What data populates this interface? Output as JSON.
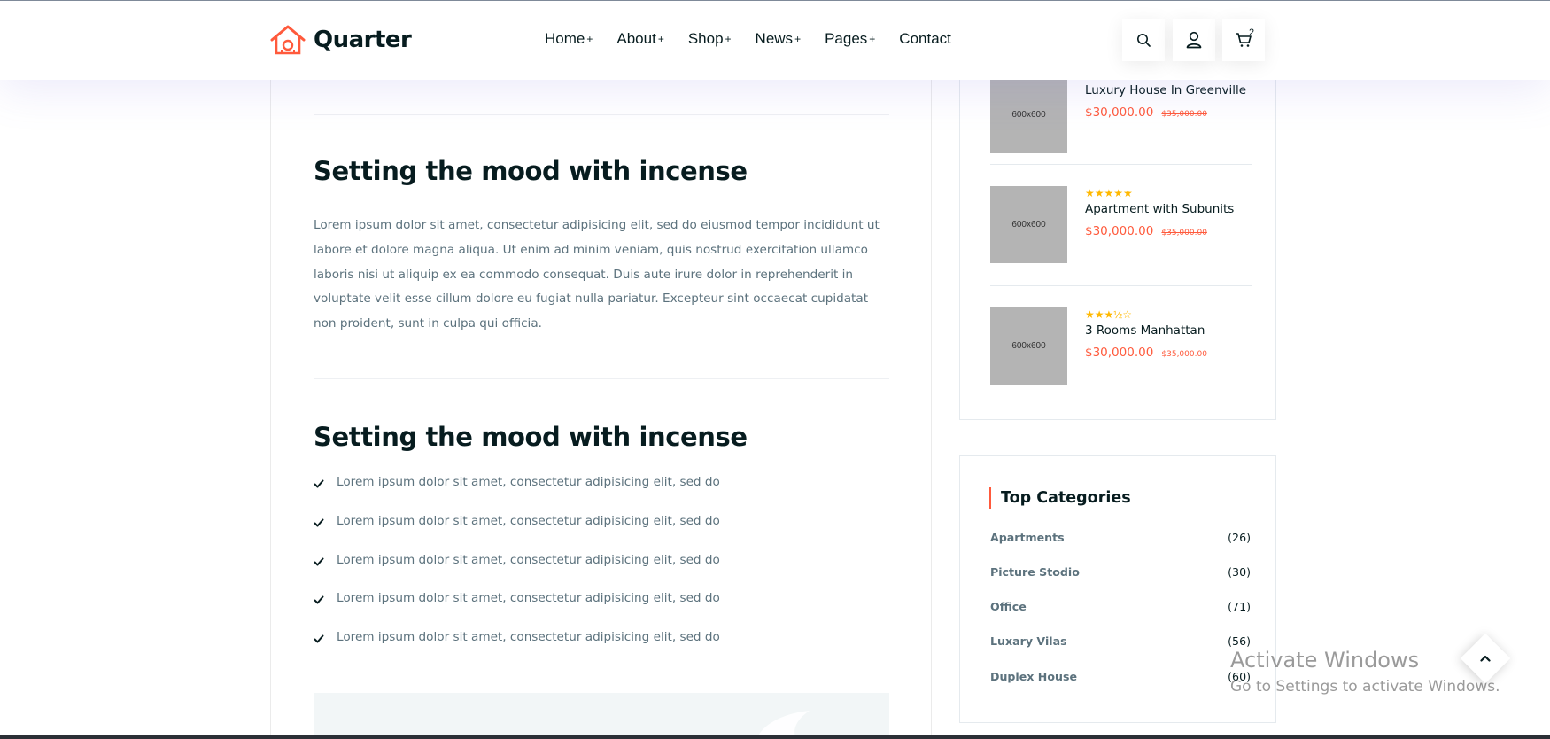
{
  "header": {
    "logo_text": "Quarter",
    "nav": [
      {
        "label": "Home",
        "suffix": "+"
      },
      {
        "label": "About",
        "suffix": "+"
      },
      {
        "label": "Shop",
        "suffix": "+"
      },
      {
        "label": "News",
        "suffix": "+"
      },
      {
        "label": "Pages",
        "suffix": "+"
      },
      {
        "label": "Contact",
        "suffix": ""
      }
    ],
    "icons": [
      "search-icon",
      "user-icon",
      "cart-icon"
    ],
    "cart_count": "2"
  },
  "main": {
    "section1": {
      "title": "Setting the mood with incense",
      "body": "Lorem ipsum dolor sit amet, consectetur adipisicing elit, sed do eiusmod tempor incididunt ut labore et dolore magna aliqua. Ut enim ad minim veniam, quis nostrud exercitation ullamco laboris nisi ut aliquip ex ea commodo consequat. Duis aute irure dolor in reprehenderit in voluptate velit esse cillum dolore eu fugiat nulla pariatur. Excepteur sint occaecat cupidatat non proident, sunt in culpa qui officia."
    },
    "section2": {
      "title": "Setting the mood with incense",
      "items": [
        "Lorem ipsum dolor sit amet, consectetur adipisicing elit, sed do",
        "Lorem ipsum dolor sit amet, consectetur adipisicing elit, sed do",
        "Lorem ipsum dolor sit amet, consectetur adipisicing elit, sed do",
        "Lorem ipsum dolor sit amet, consectetur adipisicing elit, sed do",
        "Lorem ipsum dolor sit amet, consectetur adipisicing elit, sed do"
      ]
    }
  },
  "sidebar": {
    "products": [
      {
        "thumb": "600x600",
        "name": "Luxury House In Greenville",
        "price": "$30,000.00",
        "old_price": "$35,000.00",
        "rating": null
      },
      {
        "thumb": "600x600",
        "name": "Apartment with Subunits",
        "price": "$30,000.00",
        "old_price": "$35,000.00",
        "rating": "★★★★★"
      },
      {
        "thumb": "600x600",
        "name": "3 Rooms Manhattan",
        "price": "$30,000.00",
        "old_price": "$35,000.00",
        "rating": "★★★½☆"
      }
    ],
    "categories": {
      "title": "Top Categories",
      "items": [
        {
          "name": "Apartments",
          "count": "(26)"
        },
        {
          "name": "Picture Stodio",
          "count": "(30)"
        },
        {
          "name": "Office",
          "count": "(71)"
        },
        {
          "name": "Luxary Vilas",
          "count": "(56)"
        },
        {
          "name": "Duplex House",
          "count": "(60)"
        }
      ]
    }
  },
  "overlay": {
    "watermark_line1": "Activate Windows",
    "watermark_line2": "Go to Settings to activate Windows.",
    "scroll_top_icon": "chevron-up-icon"
  },
  "colors": {
    "accent": "#ff5a3c",
    "heading": "#071c1f",
    "body": "#5c727d",
    "star": "#ffb800",
    "thumb": "#b4b4b4"
  }
}
